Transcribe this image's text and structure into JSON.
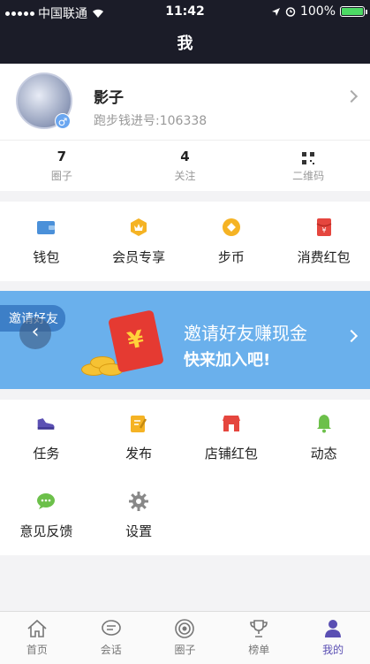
{
  "status_bar": {
    "carrier": "中国联通",
    "time": "11:42",
    "battery": "100%",
    "battery_level": 1.0
  },
  "header": {
    "title": "我"
  },
  "profile": {
    "name": "影子",
    "account_id": "跑步钱进号:106338",
    "gender_symbol": "♂"
  },
  "stats": [
    {
      "value": "7",
      "label": "圈子"
    },
    {
      "value": "4",
      "label": "关注"
    },
    {
      "label": "二维码"
    }
  ],
  "wallet_row": [
    {
      "label": "钱包",
      "icon": "wallet-icon",
      "color": "#4a90d9"
    },
    {
      "label": "会员专享",
      "icon": "vip-badge-icon",
      "color": "#f5b324"
    },
    {
      "label": "步币",
      "icon": "coin-icon",
      "color": "#f5b324"
    },
    {
      "label": "消费红包",
      "icon": "red-packet-icon",
      "color": "#e5463e"
    }
  ],
  "banner": {
    "tag": "邀请好友",
    "line1": "邀请好友赚现金",
    "line2": "快来加入吧!",
    "redpack_symbol": "¥"
  },
  "grid": [
    {
      "label": "任务",
      "icon": "sneaker-icon",
      "color": "#5b50b3"
    },
    {
      "label": "发布",
      "icon": "edit-icon",
      "color": "#f5b324"
    },
    {
      "label": "店铺红包",
      "icon": "shop-icon",
      "color": "#e5463e"
    },
    {
      "label": "动态",
      "icon": "bell-icon",
      "color": "#6cc04a"
    },
    {
      "label": "意见反馈",
      "icon": "chat-bubble-icon",
      "color": "#6cc04a"
    },
    {
      "label": "设置",
      "icon": "gear-icon",
      "color": "#888888"
    }
  ],
  "tab_bar": [
    {
      "label": "首页",
      "icon": "home-icon"
    },
    {
      "label": "会话",
      "icon": "message-icon"
    },
    {
      "label": "圈子",
      "icon": "target-icon"
    },
    {
      "label": "榜单",
      "icon": "trophy-icon"
    },
    {
      "label": "我的",
      "icon": "user-icon",
      "active": true
    }
  ],
  "colors": {
    "header_bg": "#1b1c28",
    "banner_bg": "#6ab0ec",
    "accent": "#5a4fb3"
  }
}
